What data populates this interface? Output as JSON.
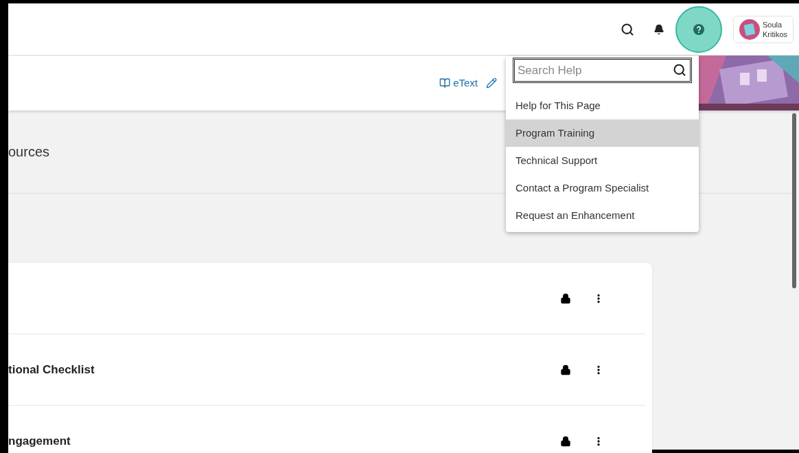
{
  "top_bar": {
    "user": {
      "first_name": "Soula",
      "last_name": "Kritikos"
    }
  },
  "sub_bar": {
    "links": [
      {
        "label": "eText"
      }
    ]
  },
  "section": {
    "title": "ources"
  },
  "rows": [
    {
      "title": "",
      "locked": true
    },
    {
      "title": "tional Checklist",
      "locked": true
    },
    {
      "title": "ngagement",
      "locked": true
    }
  ],
  "help_menu": {
    "search": {
      "placeholder": "Search Help"
    },
    "items": [
      {
        "label": "Help for This Page",
        "selected": false
      },
      {
        "label": "Program Training",
        "selected": true
      },
      {
        "label": "Technical Support",
        "selected": false
      },
      {
        "label": "Contact a Program Specialist",
        "selected": false
      },
      {
        "label": "Request an Enhancement",
        "selected": false
      }
    ]
  }
}
